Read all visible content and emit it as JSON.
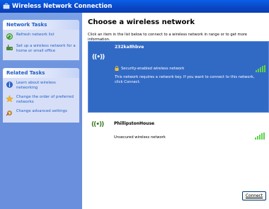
{
  "window": {
    "title": "Wireless Network Connection"
  },
  "sidebar": {
    "network_tasks": {
      "title": "Network Tasks",
      "items": [
        {
          "label": "Refresh network list",
          "icon": "refresh-icon"
        },
        {
          "label": "Set up a wireless network for a home or small office",
          "icon": "setup-wireless-icon"
        }
      ]
    },
    "related_tasks": {
      "title": "Related Tasks",
      "items": [
        {
          "label": "Learn about wireless networking",
          "icon": "info-icon"
        },
        {
          "label": "Change the order of preferred networks",
          "icon": "star-icon"
        },
        {
          "label": "Change advanced settings",
          "icon": "settings-icon"
        }
      ]
    }
  },
  "main": {
    "title": "Choose a wireless network",
    "instructions": "Click an item in the list below to connect to a wireless network in range or to get more information.",
    "networks": [
      {
        "ssid": "232ka8hbve",
        "security": "Security-enabled wireless network",
        "description": "This network requires a network key. If you want to connect to this network, click Connect.",
        "signal_bars": 5,
        "selected": true
      },
      {
        "ssid": "PhillipstonHouse",
        "security": "Unsecured wireless network",
        "signal_bars": 5,
        "selected": false
      }
    ],
    "connect_label": "Connect"
  },
  "colors": {
    "titlebar": "#0a46c4",
    "selected_row": "#316ac5",
    "signal": "#5fd24a",
    "task_link": "#215dc6"
  }
}
